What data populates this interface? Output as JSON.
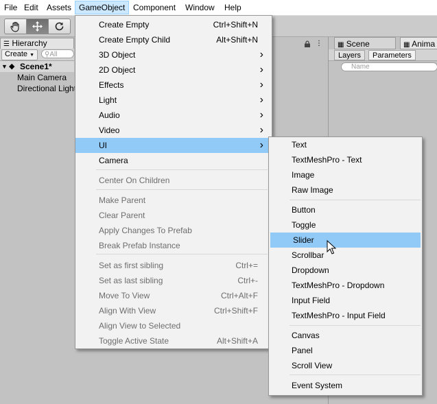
{
  "menubar": {
    "items": [
      {
        "label": "File"
      },
      {
        "label": "Edit"
      },
      {
        "label": "Assets"
      },
      {
        "label": "GameObject"
      },
      {
        "label": "Component"
      },
      {
        "label": "Window"
      },
      {
        "label": "Help"
      }
    ],
    "active": "GameObject"
  },
  "toolbar": {
    "tools": [
      "hand-tool",
      "move-tool",
      "rotate-tool"
    ],
    "selected": "move-tool"
  },
  "hierarchy": {
    "tab_label": "Hierarchy",
    "create_label": "Create",
    "search_placeholder": "All",
    "scene_name": "Scene1*",
    "objects": [
      "Main Camera",
      "Directional Light"
    ]
  },
  "right_panel": {
    "tabs": [
      "Scene",
      "Anima"
    ],
    "subtabs": [
      "Layers",
      "Parameters"
    ],
    "search_placeholder": "Name"
  },
  "gameobject_menu": {
    "items": [
      {
        "label": "Create Empty",
        "shortcut": "Ctrl+Shift+N",
        "disabled": false
      },
      {
        "label": "Create Empty Child",
        "shortcut": "Alt+Shift+N",
        "disabled": false
      },
      {
        "label": "3D Object",
        "submenu": true,
        "disabled": false
      },
      {
        "label": "2D Object",
        "submenu": true,
        "disabled": false
      },
      {
        "label": "Effects",
        "submenu": true,
        "disabled": false
      },
      {
        "label": "Light",
        "submenu": true,
        "disabled": false
      },
      {
        "label": "Audio",
        "submenu": true,
        "disabled": false
      },
      {
        "label": "Video",
        "submenu": true,
        "disabled": false
      },
      {
        "label": "UI",
        "submenu": true,
        "disabled": false,
        "highlighted": true
      },
      {
        "label": "Camera",
        "disabled": false
      },
      {
        "label": "Center On Children",
        "disabled": true
      },
      {
        "label": "Make Parent",
        "disabled": true
      },
      {
        "label": "Clear Parent",
        "disabled": true
      },
      {
        "label": "Apply Changes To Prefab",
        "disabled": true
      },
      {
        "label": "Break Prefab Instance",
        "disabled": true
      },
      {
        "label": "Set as first sibling",
        "shortcut": "Ctrl+=",
        "disabled": true
      },
      {
        "label": "Set as last sibling",
        "shortcut": "Ctrl+-",
        "disabled": true
      },
      {
        "label": "Move To View",
        "shortcut": "Ctrl+Alt+F",
        "disabled": true
      },
      {
        "label": "Align With View",
        "shortcut": "Ctrl+Shift+F",
        "disabled": true
      },
      {
        "label": "Align View to Selected",
        "disabled": true
      },
      {
        "label": "Toggle Active State",
        "shortcut": "Alt+Shift+A",
        "disabled": true
      }
    ]
  },
  "ui_submenu": {
    "items": [
      {
        "label": "Text"
      },
      {
        "label": "TextMeshPro - Text"
      },
      {
        "label": "Image"
      },
      {
        "label": "Raw Image"
      },
      {
        "label": "Button"
      },
      {
        "label": "Toggle"
      },
      {
        "label": "Slider",
        "highlighted": true
      },
      {
        "label": "Scrollbar"
      },
      {
        "label": "Dropdown"
      },
      {
        "label": "TextMeshPro - Dropdown"
      },
      {
        "label": "Input Field"
      },
      {
        "label": "TextMeshPro - Input Field"
      },
      {
        "label": "Canvas"
      },
      {
        "label": "Panel"
      },
      {
        "label": "Scroll View"
      },
      {
        "label": "Event System"
      }
    ]
  },
  "colors": {
    "menu_highlight": "#91c9f7",
    "menubar_active": "#cce8ff",
    "disabled_text": "#6d6d6d"
  }
}
